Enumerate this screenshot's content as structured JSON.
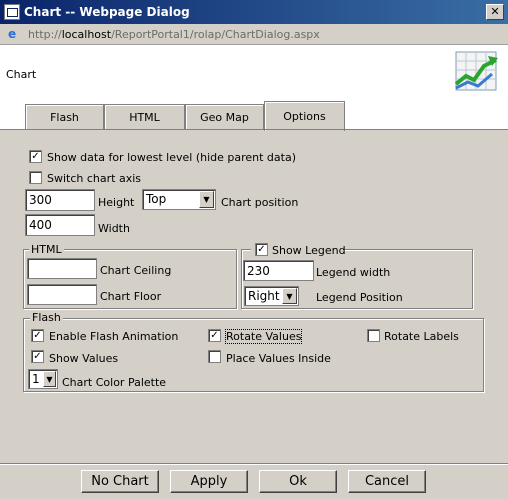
{
  "window": {
    "title": "Chart -- Webpage Dialog",
    "close_glyph": "✕"
  },
  "urlbar": {
    "prefix": "http://",
    "host": "localhost",
    "path": "/ReportPortal1/rolap/ChartDialog.aspx",
    "ie_glyph": "e"
  },
  "header": {
    "title": "Chart"
  },
  "tabs": [
    {
      "label": "Flash"
    },
    {
      "label": "HTML"
    },
    {
      "label": "Geo Map"
    },
    {
      "label": "Options"
    }
  ],
  "options": {
    "show_lowest_level": {
      "label": "Show data for lowest level (hide parent data)",
      "checked": true
    },
    "switch_axis": {
      "label": "Switch chart axis",
      "checked": false
    },
    "height": {
      "value": "300",
      "label": "Height"
    },
    "position": {
      "value": "Top",
      "label": "Chart position"
    },
    "width": {
      "value": "400",
      "label": "Width"
    }
  },
  "html_group": {
    "legend": "HTML",
    "ceiling": {
      "value": "",
      "label": "Chart Ceiling"
    },
    "floor": {
      "value": "",
      "label": "Chart Floor"
    }
  },
  "legend_group": {
    "show_legend": {
      "label": "Show Legend",
      "checked": true
    },
    "width": {
      "value": "230",
      "label": "Legend width"
    },
    "position": {
      "value": "Right",
      "label": "Legend Position"
    }
  },
  "flash_group": {
    "legend": "Flash",
    "enable_animation": {
      "label": "Enable Flash Animation",
      "checked": true
    },
    "rotate_values": {
      "label": "Rotate Values",
      "checked": true
    },
    "rotate_labels": {
      "label": "Rotate Labels",
      "checked": false
    },
    "show_values": {
      "label": "Show Values",
      "checked": true
    },
    "values_inside": {
      "label": "Place Values Inside",
      "checked": false
    },
    "palette": {
      "value": "1",
      "label": "Chart Color Palette"
    }
  },
  "buttons": {
    "no_chart": "No Chart",
    "apply": "Apply",
    "ok": "Ok",
    "cancel": "Cancel"
  },
  "check_glyph": "✓",
  "arrow_glyph": "▼"
}
